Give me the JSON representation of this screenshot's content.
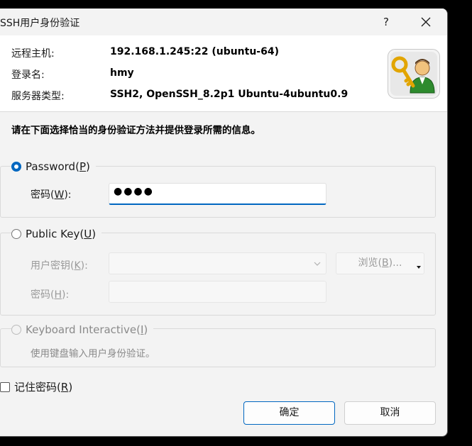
{
  "window": {
    "title": "SSH用户身份验证",
    "help_label": "?"
  },
  "info": {
    "host_label": "远程主机:",
    "host_value": "192.168.1.245:22 (ubuntu-64)",
    "login_label": "登录名:",
    "login_value": "hmy",
    "server_label": "服务器类型:",
    "server_value": "SSH2, OpenSSH_8.2p1 Ubuntu-4ubuntu0.9"
  },
  "instruction": "请在下面选择恰当的身份验证方法并提供登录所需的信息。",
  "password_group": {
    "option_label": "Password",
    "option_key": "P",
    "selected": true,
    "field_label": "密码",
    "field_key": "W",
    "field_value": "●●●●"
  },
  "publickey_group": {
    "option_label": "Public Key",
    "option_key": "U",
    "selected": false,
    "key_label": "用户密钥",
    "key_key": "K",
    "key_value": "",
    "browse_label": "浏览",
    "browse_key": "B",
    "pass_label": "密码",
    "pass_key": "H",
    "pass_value": ""
  },
  "keyboard_group": {
    "option_label": "Keyboard Interactive",
    "option_key": "I",
    "selected": false,
    "hint": "使用键盘输入用户身份验证。"
  },
  "remember": {
    "label": "记住密码",
    "key": "R",
    "checked": false
  },
  "buttons": {
    "ok": "确定",
    "cancel": "取消"
  },
  "colors": {
    "accent": "#0067c0",
    "panel": "#ffffff",
    "background": "#f3f3f3"
  }
}
